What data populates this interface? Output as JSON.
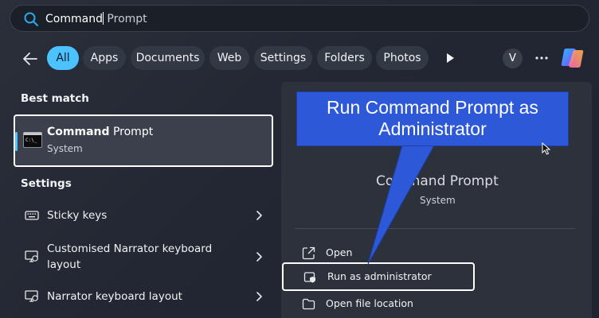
{
  "search": {
    "typed": "Command",
    "hint": " Prompt"
  },
  "filters": [
    {
      "label": "All",
      "active": true
    },
    {
      "label": "Apps"
    },
    {
      "label": "Documents"
    },
    {
      "label": "Web"
    },
    {
      "label": "Settings"
    },
    {
      "label": "Folders"
    },
    {
      "label": "Photos"
    }
  ],
  "account": {
    "initial": "V"
  },
  "best_match": {
    "heading": "Best match",
    "title_bold": "Command",
    "title_rest": " Prompt",
    "subtitle": "System",
    "icon": "cmd-terminal-icon"
  },
  "settings": {
    "heading": "Settings",
    "items": [
      {
        "line1": "Sticky keys",
        "line2": "",
        "icon": "keyboard-icon"
      },
      {
        "line1": "Customised Narrator keyboard",
        "line2": "layout",
        "icon": "narrator-monitor-icon"
      },
      {
        "line1": "Narrator keyboard layout",
        "line2": "",
        "icon": "narrator-monitor-icon"
      }
    ]
  },
  "detail": {
    "title": "Command Prompt",
    "subtitle": "System",
    "actions": [
      {
        "label": "Open",
        "icon": "open-external-icon"
      },
      {
        "label": "Run as administrator",
        "icon": "shield-admin-icon"
      },
      {
        "label": "Open file location",
        "icon": "folder-icon"
      }
    ]
  },
  "callout": {
    "line1": "Run Command Prompt as",
    "line2": "Administrator",
    "color": "#2d59d8"
  },
  "colors": {
    "accent": "#4cc2ff",
    "chip_bg": "#333845"
  }
}
